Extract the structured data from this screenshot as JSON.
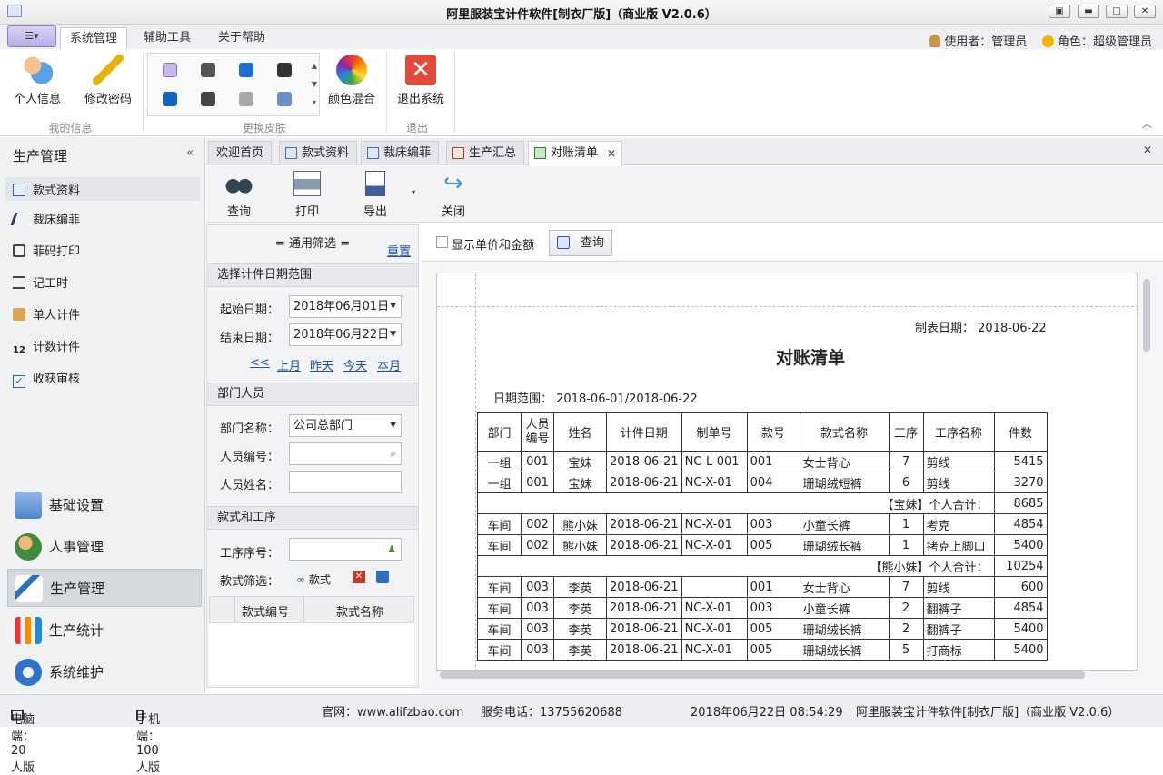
{
  "window": {
    "title": "阿里服装宝计件软件[制衣厂版]（商业版 V2.0.6）"
  },
  "ribbon_tabs": [
    "系统管理",
    "辅助工具",
    "关于帮助"
  ],
  "user": {
    "user_label": "使用者：管理员",
    "role_label": "角色：超级管理员"
  },
  "ribbon": {
    "personal_info": "个人信息",
    "change_password": "修改密码",
    "group_myinfo": "我的信息",
    "group_skin": "更换皮肤",
    "color_mix": "颜色混合",
    "exit_system": "退出系统",
    "group_exit": "退出"
  },
  "leftpanel": {
    "title": "生产管理",
    "items": [
      "款式资料",
      "裁床编菲",
      "菲码打印",
      "记工时",
      "单人计件",
      "计数计件",
      "收获审核"
    ],
    "modules": [
      "基础设置",
      "人事管理",
      "生产管理",
      "生产统计",
      "系统维护"
    ]
  },
  "doc_tabs": [
    "欢迎首页",
    "款式资料",
    "裁床编菲",
    "生产汇总",
    "对账清单"
  ],
  "toolbar": {
    "query": "查询",
    "print": "打印",
    "export": "导出",
    "close": "关闭"
  },
  "filter": {
    "header": "= 通用筛选 =",
    "reset": "重置",
    "sec_date": "选择计件日期范围",
    "start_label": "起始日期：",
    "start_value": "2018年06月01日",
    "end_label": "结束日期：",
    "end_value": "2018年06月22日",
    "quick": [
      "<<",
      "上月",
      "昨天",
      "今天",
      "本月"
    ],
    "sec_dept": "部门人员",
    "dept_label": "部门名称：",
    "dept_value": "公司总部门",
    "emp_no_label": "人员编号：",
    "emp_name_label": "人员姓名：",
    "sec_style": "款式和工序",
    "proc_label": "工序序号：",
    "style_filter_label": "款式筛选：",
    "style_btn": "款式",
    "col_style_no": "款式编号",
    "col_style_name": "款式名称"
  },
  "report_bar": {
    "show_price": "显示单价和金额",
    "query": "查询"
  },
  "report": {
    "made_date_label": "制表日期：",
    "made_date": "2018-06-22",
    "title": "对账清单",
    "range_label": "日期范围：",
    "range": "2018-06-01/2018-06-22",
    "headers": [
      "部门",
      "人员编号",
      "姓名",
      "计件日期",
      "制单号",
      "款号",
      "款式名称",
      "工序",
      "工序名称",
      "件数"
    ],
    "rows": [
      [
        "一组",
        "001",
        "宝妹",
        "2018-06-21",
        "NC-L-001",
        "001",
        "女士背心",
        "7",
        "剪线",
        "5415"
      ],
      [
        "一组",
        "001",
        "宝妹",
        "2018-06-21",
        "NC-X-01",
        "004",
        "珊瑚绒短裤",
        "6",
        "剪线",
        "3270"
      ],
      [
        "subtotal",
        "【宝妹】个人合计：",
        "8685"
      ],
      [
        "车间",
        "002",
        "熊小妹",
        "2018-06-21",
        "NC-X-01",
        "003",
        "小童长裤",
        "1",
        "考克",
        "4854"
      ],
      [
        "车间",
        "002",
        "熊小妹",
        "2018-06-21",
        "NC-X-01",
        "005",
        "珊瑚绒长裤",
        "1",
        "拷克上脚口",
        "5400"
      ],
      [
        "subtotal",
        "【熊小妹】个人合计：",
        "10254"
      ],
      [
        "车间",
        "003",
        "李英",
        "2018-06-21",
        "",
        "001",
        "女士背心",
        "7",
        "剪线",
        "600"
      ],
      [
        "车间",
        "003",
        "李英",
        "2018-06-21",
        "NC-X-01",
        "003",
        "小童长裤",
        "2",
        "翻裤子",
        "4854"
      ],
      [
        "车间",
        "003",
        "李英",
        "2018-06-21",
        "NC-X-01",
        "005",
        "珊瑚绒长裤",
        "2",
        "翻裤子",
        "5400"
      ],
      [
        "车间",
        "003",
        "李英",
        "2018-06-21",
        "NC-X-01",
        "005",
        "珊瑚绒长裤",
        "5",
        "打商标",
        "5400"
      ]
    ]
  },
  "status": {
    "pc": "电脑端：20人版",
    "mobile": "手机端：100人版",
    "site": "官网：www.alifzbao.com",
    "phone": "服务电话：13755620688",
    "datetime": "2018年06月22日 08:54:29",
    "product": "阿里服装宝计件软件[制衣厂版]（商业版 V2.0.6）"
  }
}
